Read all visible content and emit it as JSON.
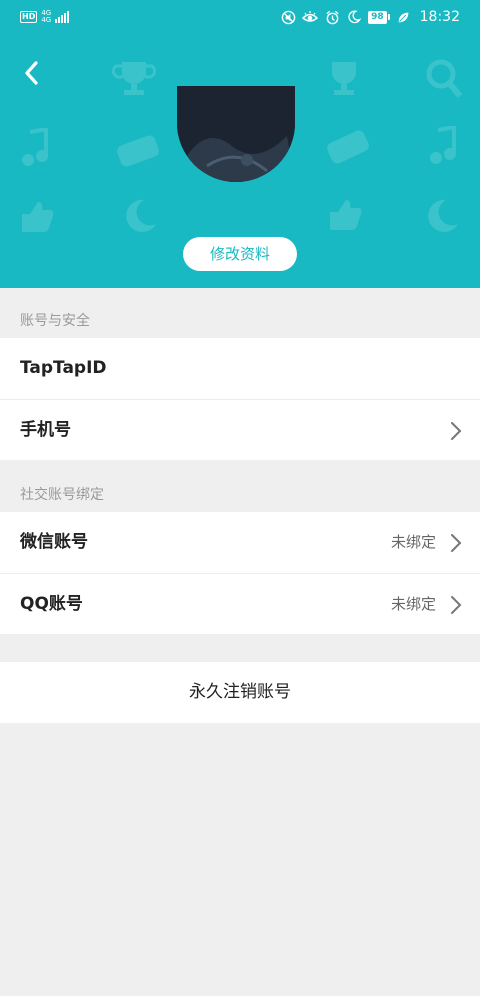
{
  "status_bar": {
    "hd_badge": "HD",
    "network": "4G",
    "network_sub": "4G",
    "battery": "98",
    "time": "18:32",
    "icons": [
      "mute-icon",
      "eye-comfort-icon",
      "alarm-icon",
      "moon-icon",
      "battery-icon",
      "leaf-icon"
    ]
  },
  "header": {
    "background_color": "#19b9c3",
    "back_icon": "chevron-left-icon",
    "decor_icons": [
      "trophy-icon",
      "gamepad-icon",
      "search-icon",
      "music-note-icon",
      "controller-icon",
      "thumbs-up-icon",
      "moon-icon"
    ],
    "edit_profile_label": "修改资料"
  },
  "account_security": {
    "section_title": "账号与安全",
    "rows": [
      {
        "label": "TapTapID"
      },
      {
        "label": "手机号"
      }
    ]
  },
  "social_binding": {
    "section_title": "社交账号绑定",
    "rows": [
      {
        "label": "微信账号",
        "value": "未绑定"
      },
      {
        "label": "QQ账号",
        "value": "未绑定"
      }
    ]
  },
  "delete_account_label": "永久注销账号"
}
